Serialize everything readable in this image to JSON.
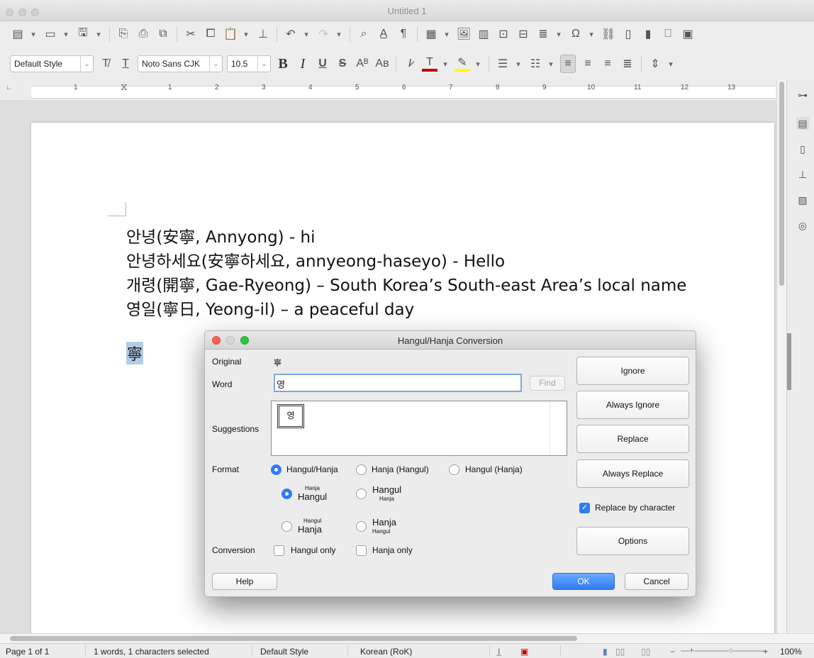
{
  "window": {
    "title": "Untitled 1"
  },
  "format_toolbar": {
    "paragraph_style": "Default Style",
    "font_name": "Noto Sans CJK",
    "font_size": "10.5"
  },
  "ruler": {
    "marks": [
      "1",
      "1",
      "2",
      "3",
      "4",
      "5",
      "6",
      "7",
      "8",
      "9",
      "10",
      "11",
      "12",
      "13"
    ]
  },
  "document": {
    "lines": [
      "안녕(安寧, Annyong) - hi",
      "안녕하세요(安寧하세요, annyeong-haseyo) -  Hello",
      "개령(開寧, Gae-Ryeong) – South Korea’s South-east Area’s local name",
      "영일(寧日, Yeong-il) – a peaceful day"
    ],
    "selected_text": "寧"
  },
  "dialog": {
    "title": "Hangul/Hanja Conversion",
    "original_label": "Original",
    "original_value": "寧",
    "word_label": "Word",
    "word_value": "영",
    "find_label": "Find",
    "suggestions_label": "Suggestions",
    "suggestion_items": [
      "영"
    ],
    "format_label": "Format",
    "format_options": [
      "Hangul/Hanja",
      "Hanja (Hangul)",
      "Hangul (Hanja)"
    ],
    "ruby_options": [
      {
        "top": "Hanja",
        "main": "Hangul"
      },
      {
        "main": "Hangul",
        "bottom": "Hanja"
      },
      {
        "top": "Hangul",
        "main": "Hanja"
      },
      {
        "main": "Hanja",
        "bottom": "Hangul"
      }
    ],
    "conversion_label": "Conversion",
    "hangul_only": "Hangul only",
    "hanja_only": "Hanja only",
    "buttons": {
      "ignore": "Ignore",
      "always_ignore": "Always Ignore",
      "replace": "Replace",
      "always_replace": "Always Replace",
      "replace_by_character": "Replace by character",
      "options": "Options",
      "help": "Help",
      "ok": "OK",
      "cancel": "Cancel"
    }
  },
  "statusbar": {
    "page": "Page 1 of 1",
    "selection": "1 words, 1 characters selected",
    "style": "Default Style",
    "language": "Korean (RoK)",
    "zoom": "100%"
  },
  "colors": {
    "accent": "#2f7cf6",
    "font_color": "#c00000",
    "highlight": "#ffff00",
    "selection": "#b3cde8"
  }
}
